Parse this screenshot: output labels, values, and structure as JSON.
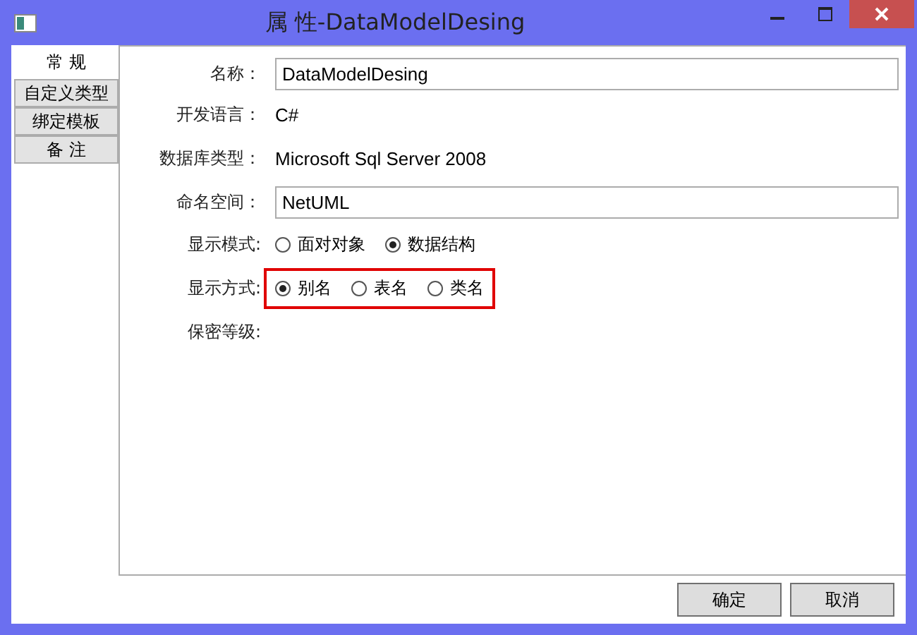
{
  "window": {
    "title": "属 性-DataModelDesing"
  },
  "tabs": [
    {
      "label": "常 规",
      "selected": true
    },
    {
      "label": "自定义类型",
      "selected": false
    },
    {
      "label": "绑定模板",
      "selected": false
    },
    {
      "label": "备 注",
      "selected": false
    }
  ],
  "form": [
    {
      "kind": "input",
      "label": "名称：",
      "value": "DataModelDesing"
    },
    {
      "kind": "text",
      "label": "开发语言：",
      "value": "C#"
    },
    {
      "kind": "text",
      "label": "数据库类型：",
      "value": "Microsoft Sql Server 2008"
    },
    {
      "kind": "input",
      "label": "命名空间：",
      "value": "NetUML"
    },
    {
      "kind": "radio",
      "label": "显示模式:",
      "highlighted": false,
      "options": [
        {
          "label": "面对对象",
          "selected": false
        },
        {
          "label": "数据结构",
          "selected": true
        }
      ]
    },
    {
      "kind": "radio",
      "label": "显示方式:",
      "highlighted": true,
      "options": [
        {
          "label": "别名",
          "selected": true
        },
        {
          "label": "表名",
          "selected": false
        },
        {
          "label": "类名",
          "selected": false
        }
      ]
    },
    {
      "kind": "empty",
      "label": "保密等级:"
    }
  ],
  "buttons": [
    "确定",
    "取消"
  ]
}
